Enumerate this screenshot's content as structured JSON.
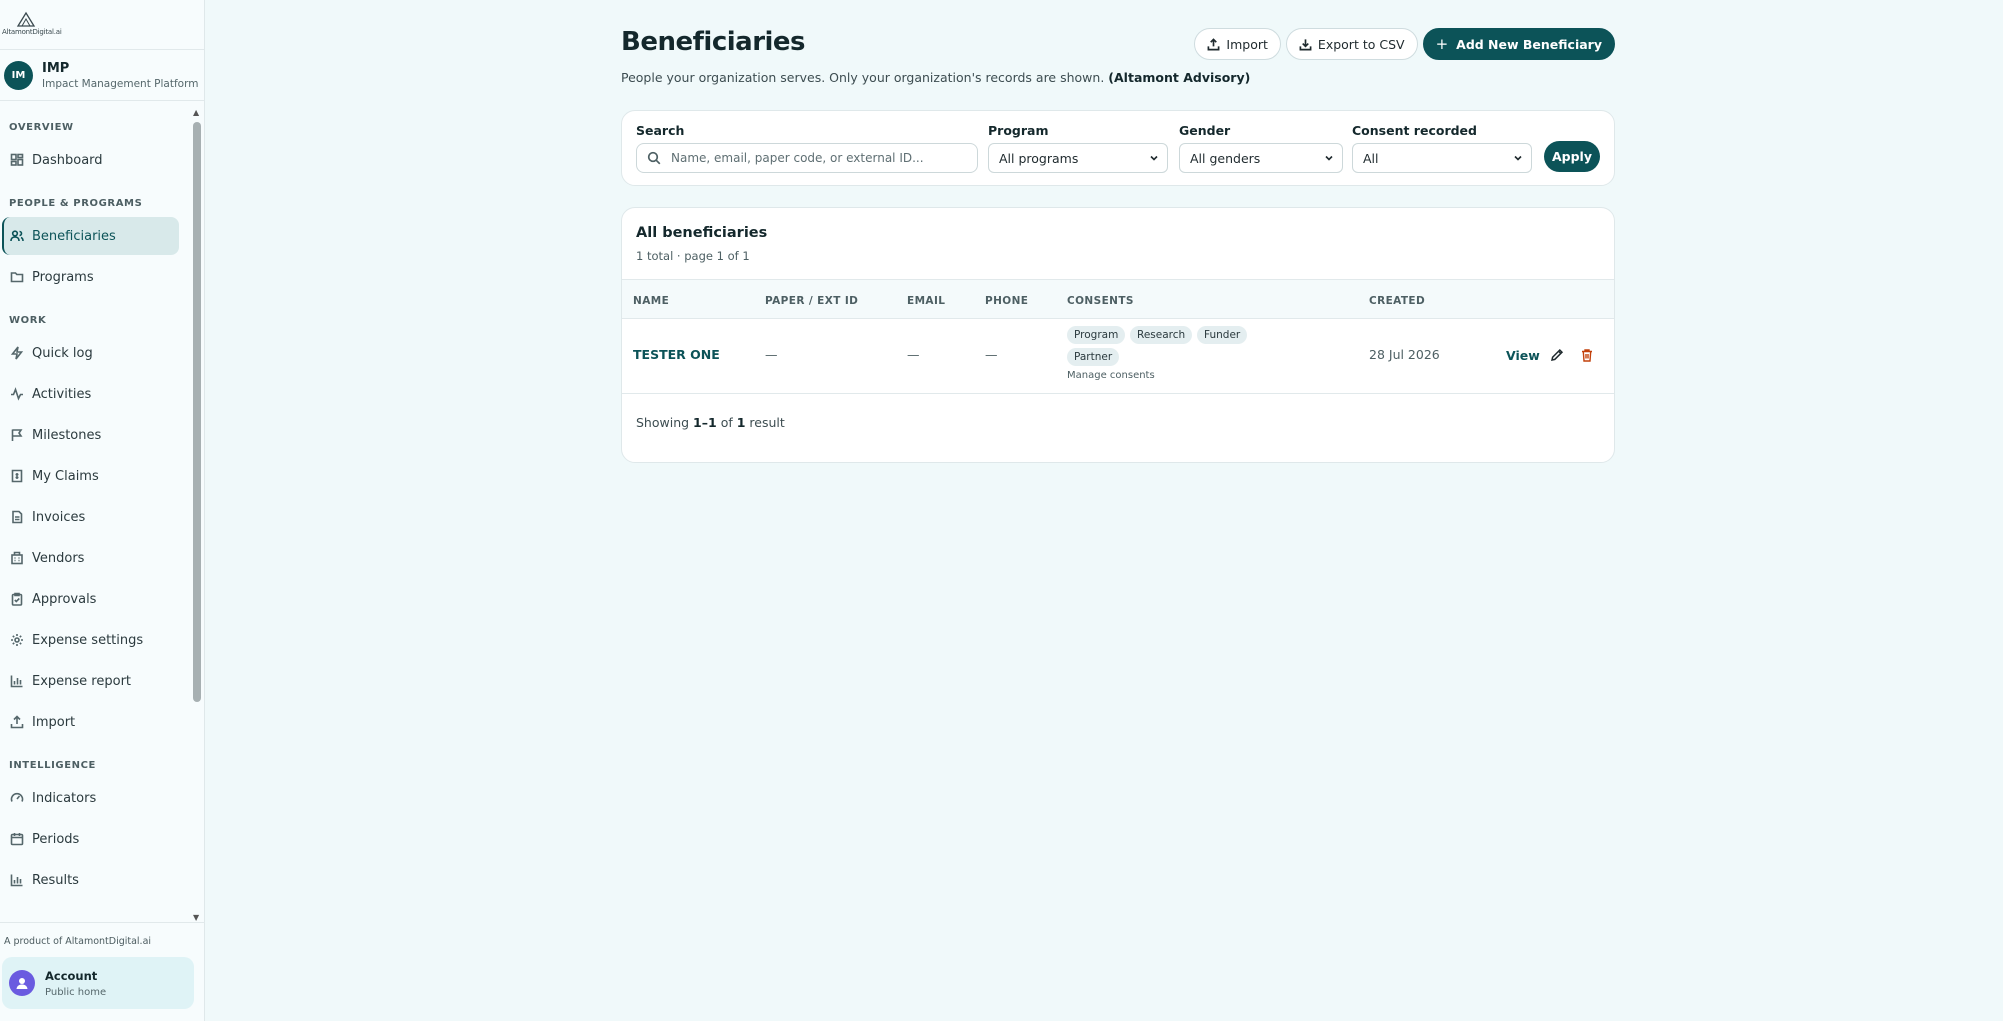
{
  "brand": {
    "logo_text": "AltamontDigital.ai"
  },
  "org": {
    "badge": "IM",
    "name": "IMP",
    "subtitle": "Impact Management Platform"
  },
  "nav": {
    "overview_title": "OVERVIEW",
    "dashboard": "Dashboard",
    "people_title": "PEOPLE & PROGRAMS",
    "beneficiaries": "Beneficiaries",
    "programs": "Programs",
    "work_title": "WORK",
    "quick_log": "Quick log",
    "activities": "Activities",
    "milestones": "Milestones",
    "my_claims": "My Claims",
    "invoices": "Invoices",
    "vendors": "Vendors",
    "approvals": "Approvals",
    "expense_settings": "Expense settings",
    "expense_report": "Expense report",
    "import": "Import",
    "intelligence_title": "INTELLIGENCE",
    "indicators": "Indicators",
    "periods": "Periods",
    "results": "Results"
  },
  "footer": {
    "product_line": "A product of AltamontDigital.ai",
    "account_name": "Account",
    "account_sub": "Public home"
  },
  "page": {
    "title": "Beneficiaries",
    "description": "People your organization serves. Only your organization's records are shown.",
    "org_name": "(Altamont Advisory)"
  },
  "actions": {
    "import": "Import",
    "export": "Export to CSV",
    "add": "Add New Beneficiary"
  },
  "filters": {
    "search_label": "Search",
    "search_placeholder": "Name, email, paper code, or external ID...",
    "program_label": "Program",
    "program_value": "All programs",
    "gender_label": "Gender",
    "gender_value": "All genders",
    "consent_label": "Consent recorded",
    "consent_value": "All",
    "apply": "Apply"
  },
  "table": {
    "title": "All beneficiaries",
    "subtitle": "1 total · page 1 of 1",
    "columns": {
      "name": "NAME",
      "paper": "PAPER / EXT ID",
      "email": "EMAIL",
      "phone": "PHONE",
      "consents": "CONSENTS",
      "created": "CREATED"
    },
    "rows": [
      {
        "name": "TESTER ONE",
        "paper": "—",
        "email": "—",
        "phone": "—",
        "consents": [
          "Program",
          "Research",
          "Funder",
          "Partner"
        ],
        "manage": "Manage consents",
        "created": "28 Jul 2026",
        "view": "View"
      }
    ],
    "footer_prefix": "Showing",
    "footer_range": "1–1",
    "footer_of": "of",
    "footer_count": "1",
    "footer_suffix": "result"
  },
  "colors": {
    "brand": "#0c5358",
    "background": "#f0f9fa",
    "delete_icon": "#c2410c"
  }
}
